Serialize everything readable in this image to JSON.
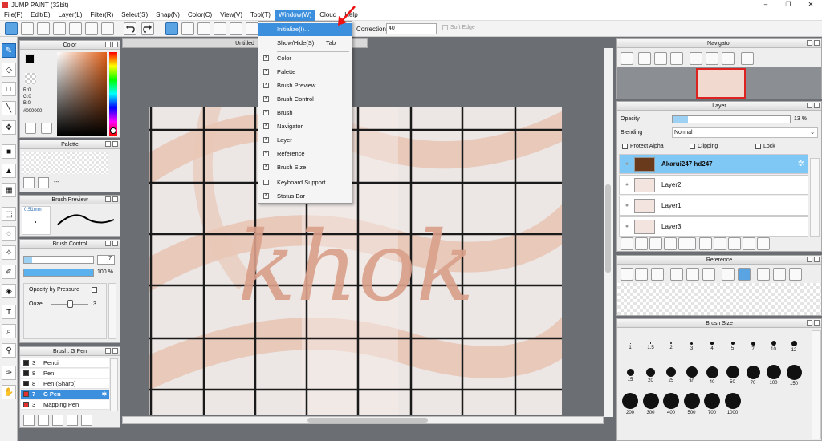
{
  "app": {
    "title": "JUMP PAINT (32bit)"
  },
  "window_controls": {
    "minimize": "–",
    "maximize": "❐",
    "close": "✕"
  },
  "menu": [
    {
      "label": "File(F)"
    },
    {
      "label": "Edit(E)"
    },
    {
      "label": "Layer(L)"
    },
    {
      "label": "Filter(R)"
    },
    {
      "label": "Select(S)"
    },
    {
      "label": "Snap(N)"
    },
    {
      "label": "Color(C)"
    },
    {
      "label": "View(V)"
    },
    {
      "label": "Tool(T)"
    },
    {
      "label": "Window(W)"
    },
    {
      "label": "Cloud"
    },
    {
      "label": "Help"
    }
  ],
  "toolbar": {
    "correction_label": "Correction",
    "correction_value": "40",
    "soft_edge_label": "Soft Edge"
  },
  "window_menu": {
    "items": [
      {
        "label": "Initialize(I)...",
        "highlighted": true,
        "check": false
      },
      {
        "label": "Show/Hide(S)",
        "shortcut": "Tab",
        "check": false
      },
      {
        "label": "Color",
        "check": true
      },
      {
        "label": "Palette",
        "check": true
      },
      {
        "label": "Brush Preview",
        "check": true
      },
      {
        "label": "Brush Control",
        "check": true
      },
      {
        "label": "Brush",
        "check": true
      },
      {
        "label": "Navigator",
        "check": true
      },
      {
        "label": "Layer",
        "check": true
      },
      {
        "label": "Reference",
        "check": true
      },
      {
        "label": "Brush Size",
        "check": true
      },
      {
        "label": "Keyboard Support",
        "check": false
      },
      {
        "label": "Status Bar",
        "check": true
      }
    ]
  },
  "document": {
    "tab_title": "Untitled",
    "canvas_text": "khok"
  },
  "color_panel": {
    "title": "Color",
    "r": "R:0",
    "g": "G:0",
    "b": "B:0",
    "hex": "#000000",
    "fg": "#000000",
    "bg": "#ffffff",
    "hue_bar": "rainbow"
  },
  "palette_panel": {
    "title": "Palette",
    "dash": "---"
  },
  "brush_preview": {
    "title": "Brush Preview",
    "size": "0.51mm"
  },
  "brush_control": {
    "title": "Brush Control",
    "size_value": "7",
    "opacity_value": "100 %",
    "opacity_fill": 1.0,
    "by_pressure": "Opacity by Pressure",
    "ooze_label": "Ooze",
    "ooze_value": "3",
    "ooze_level": 0.5
  },
  "brush_list": {
    "title": "Brush: G Pen",
    "items": [
      {
        "num": "3",
        "name": "Pencil",
        "color": "#222222"
      },
      {
        "num": "8",
        "name": "Pen",
        "color": "#222222"
      },
      {
        "num": "8",
        "name": "Pen (Sharp)",
        "color": "#222222"
      },
      {
        "num": "7",
        "name": "G Pen",
        "color": "#e03030",
        "selected": true
      },
      {
        "num": "3",
        "name": "Mapping Pen",
        "color": "#e03030"
      }
    ]
  },
  "navigator": {
    "title": "Navigator"
  },
  "layer_panel": {
    "title": "Layer",
    "opacity_label": "Opacity",
    "opacity_value": "13 %",
    "opacity_fill": 0.13,
    "blending_label": "Blending",
    "blending_value": "Normal",
    "protect_alpha": "Protect Alpha",
    "clipping": "Clipping",
    "lock": "Lock",
    "layers": [
      {
        "name": "Akarui247   hd247",
        "selected": true
      },
      {
        "name": "Layer2"
      },
      {
        "name": "Layer1"
      },
      {
        "name": "Layer3"
      }
    ]
  },
  "reference": {
    "title": "Reference"
  },
  "brush_size": {
    "title": "Brush Size",
    "sizes": [
      "1",
      "1.5",
      "2",
      "3",
      "4",
      "5",
      "7",
      "10",
      "12",
      "15",
      "20",
      "25",
      "30",
      "40",
      "50",
      "70",
      "100",
      "150",
      "200",
      "300",
      "400",
      "500",
      "700",
      "1000"
    ]
  },
  "colors": {
    "accent": "#3c8fdd",
    "canvas_bg": "#ece7e5",
    "stripe": "#e8c3b3",
    "letters": "#d9a08a"
  }
}
